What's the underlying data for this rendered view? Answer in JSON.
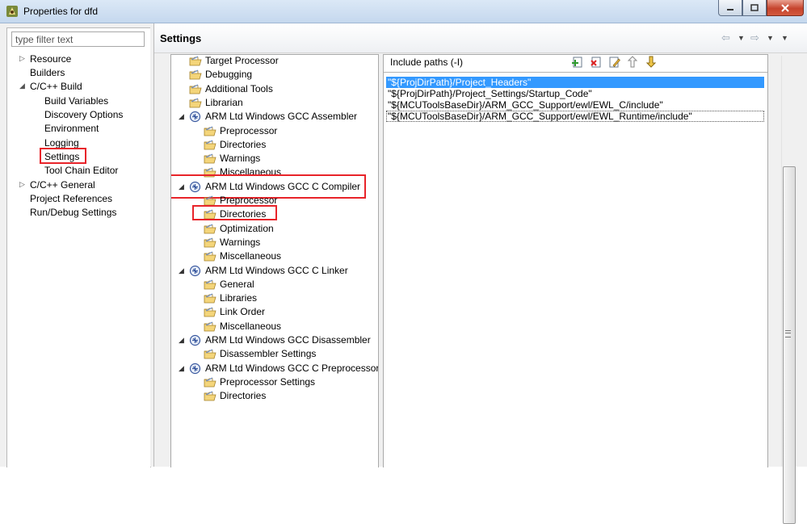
{
  "window": {
    "title": "Properties for dfd",
    "controls": {
      "minimize": "minimize-icon",
      "maximize": "maximize-icon",
      "close": "close-icon"
    }
  },
  "filter": {
    "placeholder": "type filter text",
    "value": ""
  },
  "nav": {
    "items": [
      {
        "label": "Resource",
        "expandable": true,
        "expanded": false
      },
      {
        "label": "Builders",
        "expandable": false
      },
      {
        "label": "C/C++ Build",
        "expandable": true,
        "expanded": true
      },
      {
        "label": "Build Variables",
        "indent": 1
      },
      {
        "label": "Discovery Options",
        "indent": 1
      },
      {
        "label": "Environment",
        "indent": 1
      },
      {
        "label": "Logging",
        "indent": 1
      },
      {
        "label": "Settings",
        "indent": 1,
        "selected": true
      },
      {
        "label": "Tool Chain Editor",
        "indent": 1
      },
      {
        "label": "C/C++ General",
        "expandable": true,
        "expanded": false
      },
      {
        "label": "Project References",
        "expandable": false
      },
      {
        "label": "Run/Debug Settings",
        "expandable": false
      }
    ]
  },
  "header": {
    "title": "Settings",
    "nav_icons": [
      "back-arrow-icon",
      "dropdown-icon",
      "forward-arrow-icon",
      "dropdown-icon",
      "view-menu-icon"
    ]
  },
  "tool_tree": {
    "items": [
      {
        "label": "Target Processor",
        "level": 1
      },
      {
        "label": "Debugging",
        "level": 1
      },
      {
        "label": "Additional Tools",
        "level": 1
      },
      {
        "label": "Librarian",
        "level": 1
      },
      {
        "label": "ARM Ltd Windows GCC Assembler",
        "level": 1,
        "tool": true
      },
      {
        "label": "Preprocessor",
        "level": 2
      },
      {
        "label": "Directories",
        "level": 2
      },
      {
        "label": "Warnings",
        "level": 2
      },
      {
        "label": "Miscellaneous",
        "level": 2
      },
      {
        "label": "ARM Ltd Windows GCC C Compiler",
        "level": 1,
        "tool": true,
        "highlighted": true
      },
      {
        "label": "Preprocessor",
        "level": 2
      },
      {
        "label": "Directories",
        "level": 2,
        "selected": true
      },
      {
        "label": "Optimization",
        "level": 2
      },
      {
        "label": "Warnings",
        "level": 2
      },
      {
        "label": "Miscellaneous",
        "level": 2
      },
      {
        "label": "ARM Ltd Windows GCC C Linker",
        "level": 1,
        "tool": true
      },
      {
        "label": "General",
        "level": 2
      },
      {
        "label": "Libraries",
        "level": 2
      },
      {
        "label": "Link Order",
        "level": 2
      },
      {
        "label": "Miscellaneous",
        "level": 2
      },
      {
        "label": "ARM Ltd Windows GCC Disassembler",
        "level": 1,
        "tool": true
      },
      {
        "label": "Disassembler Settings",
        "level": 2
      },
      {
        "label": "ARM Ltd Windows GCC C Preprocessor",
        "level": 1,
        "tool": true
      },
      {
        "label": "Preprocessor Settings",
        "level": 2
      },
      {
        "label": "Directories",
        "level": 2
      }
    ]
  },
  "include_paths": {
    "title": "Include paths (-I)",
    "toolbar": [
      "add-icon",
      "delete-icon",
      "edit-icon",
      "move-up-icon",
      "move-down-icon"
    ],
    "rows": [
      {
        "value": "\"${ProjDirPath}/Project_Headers\"",
        "selected": true
      },
      {
        "value": "\"${ProjDirPath}/Project_Settings/Startup_Code\""
      },
      {
        "value": "\"${MCUToolsBaseDir}/ARM_GCC_Support/ewl/EWL_C/include\""
      },
      {
        "value": "\"${MCUToolsBaseDir}/ARM_GCC_Support/ewl/EWL_Runtime/include\"",
        "focused": true
      }
    ]
  },
  "colors": {
    "selection": "#3399ff",
    "highlight_box": "#e8242a",
    "folder": "#e9c46a"
  }
}
